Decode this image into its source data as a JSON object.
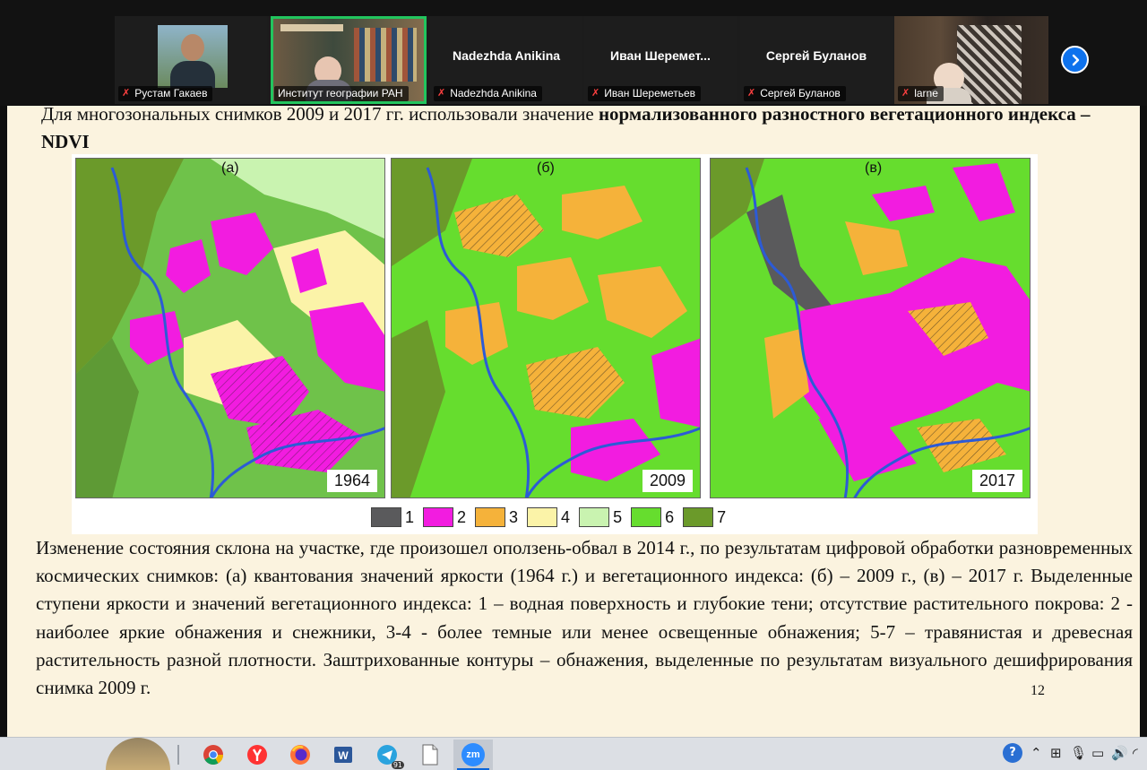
{
  "zoom": {
    "participants": [
      {
        "label": "Рустам Гакаев",
        "display_name": "",
        "muted": true,
        "video": true,
        "active": false
      },
      {
        "label": "Институт географии РАН",
        "display_name": "",
        "muted": false,
        "video": true,
        "active": true
      },
      {
        "label": "Nadezhda Anikina",
        "display_name": "Nadezhda Anikina",
        "muted": true,
        "video": false,
        "active": false
      },
      {
        "label": "Иван Шереметьев",
        "display_name": "Иван Шеремет...",
        "muted": true,
        "video": false,
        "active": false
      },
      {
        "label": "Сергей Буланов",
        "display_name": "Сергей Буланов",
        "muted": true,
        "video": false,
        "active": false
      },
      {
        "label": "larne",
        "display_name": "",
        "muted": true,
        "video": true,
        "active": false
      }
    ],
    "next_icon": "chevron-right-icon",
    "active_color": "#22c55e"
  },
  "slide": {
    "intro_plain": "Для многозональных снимков 2009 и 2017 гг. использовали значение ",
    "intro_bold": "нормализованного разностного вегетационного индекса – NDVI",
    "panels": [
      {
        "letter": "(а)",
        "year": "1964"
      },
      {
        "letter": "(б)",
        "year": "2009"
      },
      {
        "letter": "(в)",
        "year": "2017"
      }
    ],
    "legend": [
      {
        "num": "1",
        "color": "#5a5a5c"
      },
      {
        "num": "2",
        "color": "#f21ce0"
      },
      {
        "num": "3",
        "color": "#f5b23a"
      },
      {
        "num": "4",
        "color": "#fbf3a8"
      },
      {
        "num": "5",
        "color": "#c9f3b0"
      },
      {
        "num": "6",
        "color": "#66dd2e"
      },
      {
        "num": "7",
        "color": "#6b9a2a"
      }
    ],
    "caption": "Изменение состояния склона на участке, где произошел оползень-обвал в 2014 г., по результатам цифровой обработки разновременных космических снимков: (а) квантования значений яркости (1964 г.) и вегетационного индекса: (б) – 2009 г., (в) – 2017 г. Выделенные ступени яркости и значений вегетационного индекса: 1 – водная поверхность и глубокие тени; отсутствие растительного покрова: 2 - наиболее яркие обнажения и снежники, 3-4 - более темные или менее освещенные обнажения; 5-7 – травянистая и древесная растительность разной плотности. Заштрихованные контуры – обнажения, выделенные по результатам визуального дешифрирования снимка 2009 г.",
    "page_number": "12"
  },
  "taskbar": {
    "apps": [
      "chrome-icon",
      "yandex-browser-icon",
      "firefox-icon",
      "word-icon",
      "telegram-icon",
      "file-icon",
      "zoom-icon"
    ],
    "telegram_badge": "91",
    "zoom_label": "zm"
  }
}
